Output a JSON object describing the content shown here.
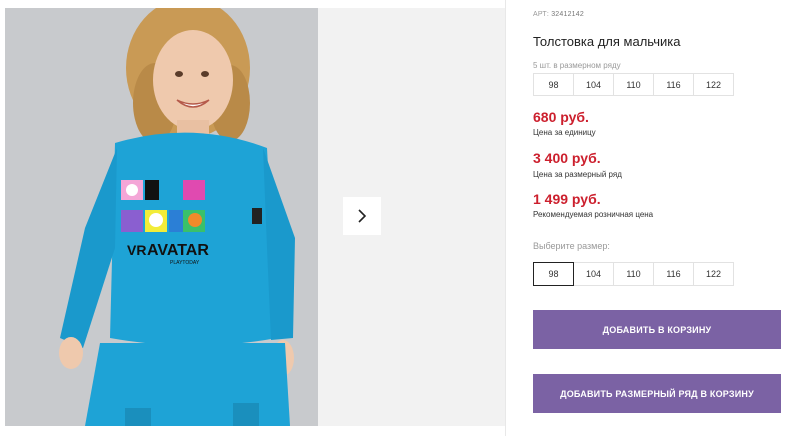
{
  "product": {
    "sku_label": "АРТ:",
    "sku_value": "32412142",
    "title": "Толстовка для мальчика",
    "pack_label": "5 шт. в размерном ряду",
    "pack_sizes": [
      "98",
      "104",
      "110",
      "116",
      "122"
    ],
    "price_unit": "680 руб.",
    "price_unit_caption": "Цена за единицу",
    "price_pack": "3 400 руб.",
    "price_pack_caption": "Цена за размерный ряд",
    "price_retail": "1 499 руб.",
    "price_retail_caption": "Рекомендуемая розничная цена",
    "choose_size_label": "Выберите размер:",
    "sizes": [
      "98",
      "104",
      "110",
      "116",
      "122"
    ],
    "selected_size": "98",
    "add_to_cart_label": "ДОБАВИТЬ В КОРЗИНУ",
    "add_pack_to_cart_label": "ДОБАВИТЬ РАЗМЕРНЫЙ РЯД В КОРЗИНУ"
  },
  "gallery": {
    "print_text": "AVATAR",
    "print_prefix": "VR",
    "print_brand": "PLAYTODAY",
    "next_icon": "chevron-right-icon"
  },
  "colors": {
    "price": "#cc1f2d",
    "button": "#7b62a4",
    "sweatshirt": "#1ea3d6"
  }
}
